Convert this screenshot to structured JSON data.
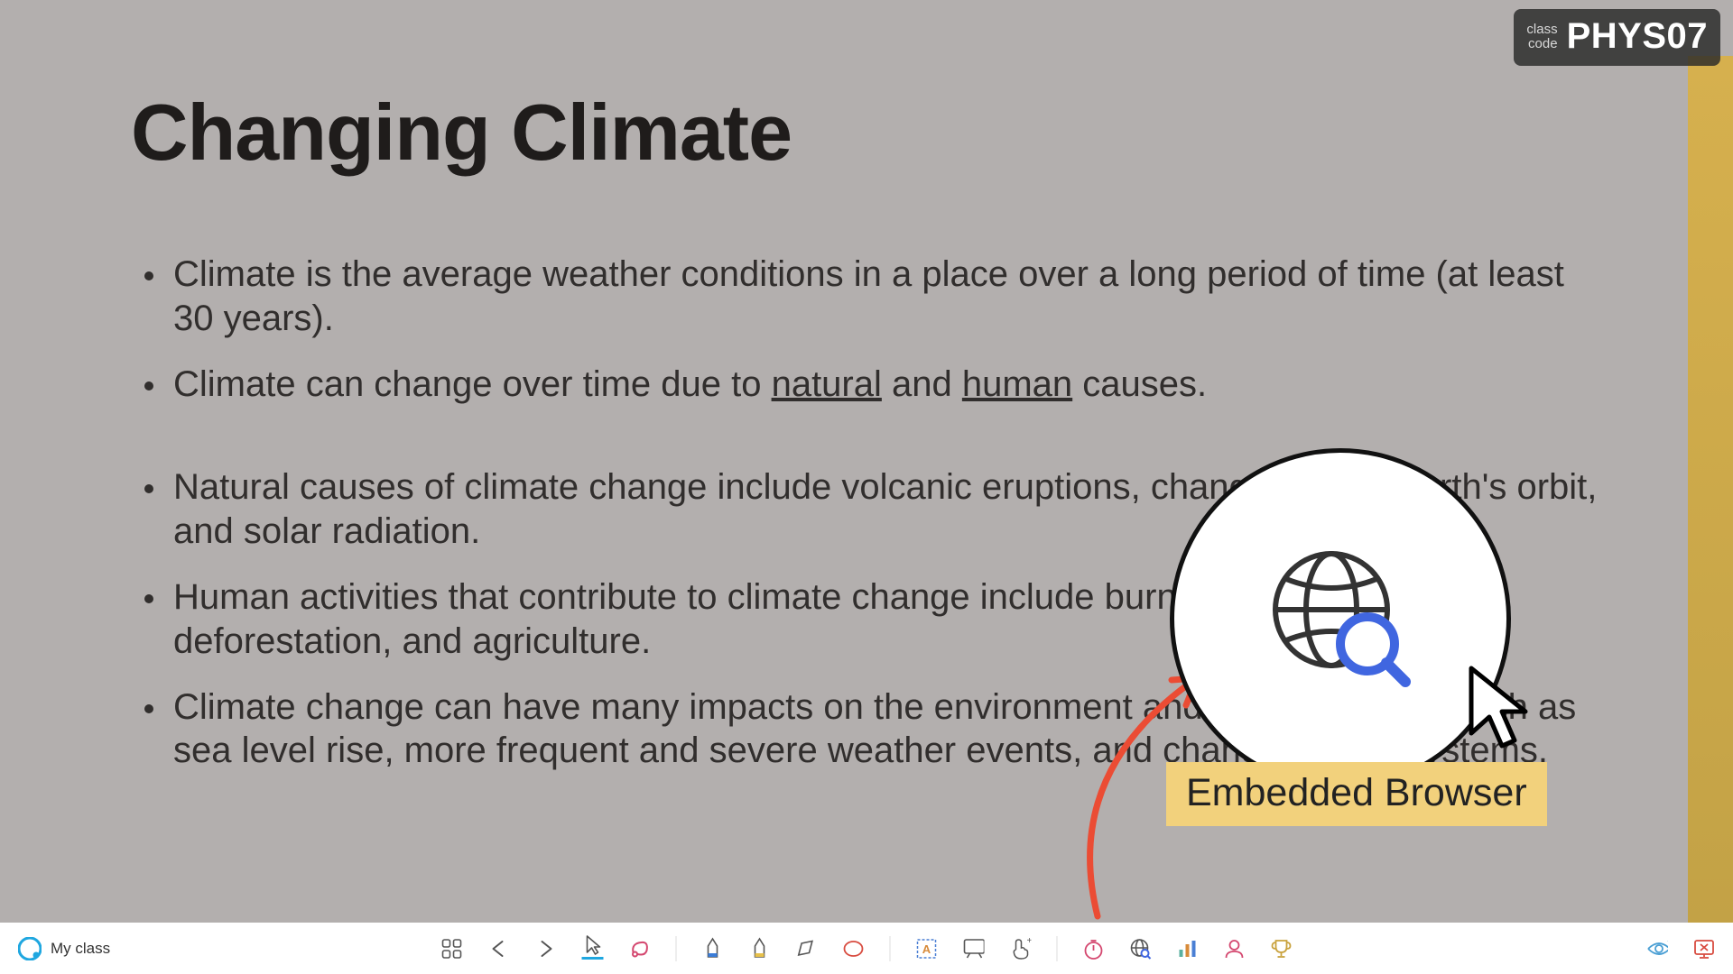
{
  "class_badge": {
    "label_line1": "class",
    "label_line2": "code",
    "code": "PHYS07"
  },
  "slide": {
    "title": "Changing Climate",
    "bullets": [
      {
        "text": "Climate is the average weather conditions in a place over a long period of time (at least 30 years)."
      },
      {
        "pre": "Climate can change over time due to ",
        "u1": "natural",
        "mid": " and ",
        "u2": "human",
        "post": " causes."
      },
      {
        "gap": true
      },
      {
        "text": "Natural causes of climate change include volcanic eruptions, changes in the Earth's orbit, and solar radiation."
      },
      {
        "text": "Human activities that contribute to climate change include burning fossil fuels, deforestation, and agriculture."
      },
      {
        "text": "Climate change can have many impacts on the environment and human health, such as sea level rise, more frequent and severe weather events, and changes in ecosystems."
      }
    ]
  },
  "toolbar": {
    "my_class": "My class",
    "icons": [
      "apps",
      "back",
      "forward",
      "cursor",
      "lasso",
      "sep",
      "highlighter1",
      "highlighter2",
      "eraser",
      "shape",
      "sep",
      "text",
      "whiteboard",
      "gesture",
      "sep",
      "timer",
      "browser",
      "poll",
      "student",
      "trophy"
    ],
    "right_icons": [
      "eye",
      "exit"
    ]
  },
  "callout": {
    "label": "Embedded Browser",
    "icon": "globe-search-icon"
  }
}
